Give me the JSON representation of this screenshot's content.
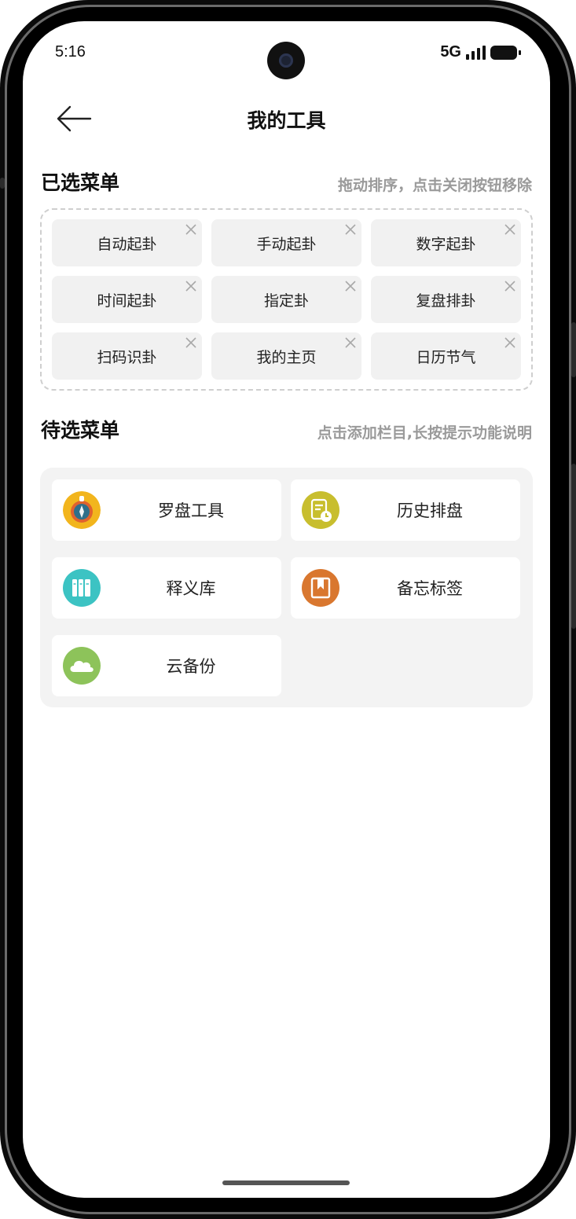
{
  "status": {
    "time": "5:16",
    "network": "5G"
  },
  "header": {
    "title": "我的工具",
    "back_icon": "arrow-left-icon"
  },
  "selected": {
    "title": "已选菜单",
    "hint": "拖动排序，点击关闭按钮移除",
    "items": [
      {
        "label": "自动起卦"
      },
      {
        "label": "手动起卦"
      },
      {
        "label": "数字起卦"
      },
      {
        "label": "时间起卦"
      },
      {
        "label": "指定卦"
      },
      {
        "label": "复盘排卦"
      },
      {
        "label": "扫码识卦"
      },
      {
        "label": "我的主页"
      },
      {
        "label": "日历节气"
      }
    ],
    "close_icon": "close-icon"
  },
  "pending": {
    "title": "待选菜单",
    "hint": "点击添加栏目,长按提示功能说明",
    "items": [
      {
        "label": "罗盘工具",
        "icon": "compass-icon",
        "color": "#f2b51d"
      },
      {
        "label": "历史排盘",
        "icon": "history-doc-icon",
        "color": "#c8be2e"
      },
      {
        "label": "释义库",
        "icon": "library-books-icon",
        "color": "#3cc3c3"
      },
      {
        "label": "备忘标签",
        "icon": "bookmark-icon",
        "color": "#d9772f"
      },
      {
        "label": "云备份",
        "icon": "cloud-icon",
        "color": "#8dc35a"
      }
    ]
  }
}
